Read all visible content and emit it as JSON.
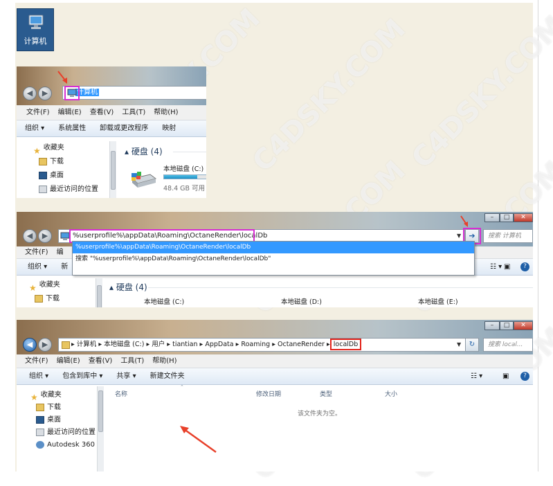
{
  "desktop": {
    "label": "计算机"
  },
  "shot1": {
    "address": "计算机",
    "menu": [
      "文件(F)",
      "编辑(E)",
      "查看(V)",
      "工具(T)",
      "帮助(H)"
    ],
    "toolbar": [
      "组织 ▾",
      "系统属性",
      "卸载或更改程序",
      "映射"
    ],
    "nav": [
      "收藏夹",
      "下载",
      "桌面",
      "最近访问的位置"
    ],
    "section": "硬盘 (4)",
    "drive": {
      "name": "本地磁盘 (C:)",
      "free": "48.4 GB 可用",
      "used_fraction": 0.7
    }
  },
  "shot2": {
    "address": "%userprofile%\\appData\\Roaming\\OctaneRender\\localDb",
    "dropdown": [
      "%userprofile%\\appData\\Roaming\\OctaneRender\\localDb",
      "搜索 \"%userprofile%\\appData\\Roaming\\OctaneRender\\localDb\""
    ],
    "search_placeholder": "搜索 计算机",
    "menu": [
      "文件(F)",
      "编"
    ],
    "toolbar": [
      "组织 ▾",
      "新"
    ],
    "nav": [
      "收藏夹",
      "下载"
    ],
    "section": "硬盘 (4)",
    "drives": [
      "本地磁盘 (C:)",
      "本地磁盘 (D:)",
      "本地磁盘 (E:)"
    ],
    "go_label": "➔",
    "minimize": "–",
    "maximize": "□",
    "close": "✕"
  },
  "shot3": {
    "breadcrumb": [
      "计算机",
      "本地磁盘 (C:)",
      "用户",
      "tiantian",
      "AppData",
      "Roaming",
      "OctaneRender",
      "localDb"
    ],
    "search_placeholder": "搜索 local...",
    "menu": [
      "文件(F)",
      "编辑(E)",
      "查看(V)",
      "工具(T)",
      "帮助(H)"
    ],
    "toolbar": [
      "组织 ▾",
      "包含到库中 ▾",
      "共享 ▾",
      "新建文件夹"
    ],
    "nav": [
      "收藏夹",
      "下载",
      "桌面",
      "最近访问的位置",
      "Autodesk 360"
    ],
    "columns": [
      "名称",
      "修改日期",
      "类型",
      "大小"
    ],
    "empty_text": "该文件夹为空。",
    "minimize": "–",
    "maximize": "□",
    "close": "✕"
  },
  "watermark": "C4DSKY.COM",
  "colors": {
    "highlight": "#3399ff",
    "magenta_box": "#d52fd2",
    "red_box": "#e2231a",
    "arrow": "#e8402a"
  }
}
